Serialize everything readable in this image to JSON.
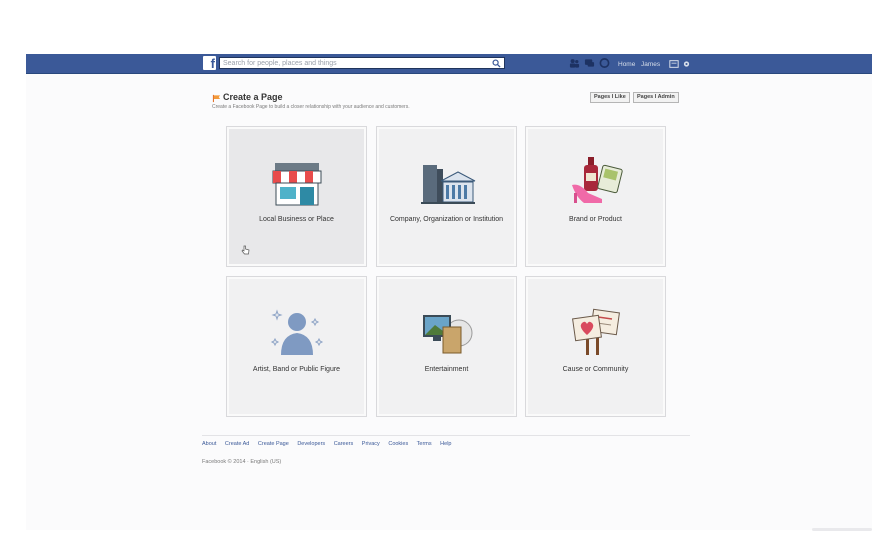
{
  "topbar": {
    "logo": "f",
    "search_placeholder": "Search for people, places and things",
    "nav": {
      "home": "Home",
      "user": "James"
    }
  },
  "header": {
    "title": "Create a Page",
    "subtitle": "Create a Facebook Page to build a closer relationship with your audience and customers.",
    "buttons": [
      "Pages I Like",
      "Pages I Admin"
    ]
  },
  "categories": [
    {
      "label": "Local Business or Place",
      "icon": "storefront-icon"
    },
    {
      "label": "Company, Organization or Institution",
      "icon": "buildings-icon"
    },
    {
      "label": "Brand or Product",
      "icon": "products-icon"
    },
    {
      "label": "Artist, Band or Public Figure",
      "icon": "silhouette-icon"
    },
    {
      "label": "Entertainment",
      "icon": "media-icon"
    },
    {
      "label": "Cause or Community",
      "icon": "signs-icon"
    }
  ],
  "footer": {
    "links": [
      "About",
      "Create Ad",
      "Create Page",
      "Developers",
      "Careers",
      "Privacy",
      "Cookies",
      "Terms",
      "Help"
    ],
    "copyright": "Facebook © 2014 · English (US)"
  },
  "colors": {
    "brand": "#3b5998",
    "tile": "#f1f1f2"
  }
}
